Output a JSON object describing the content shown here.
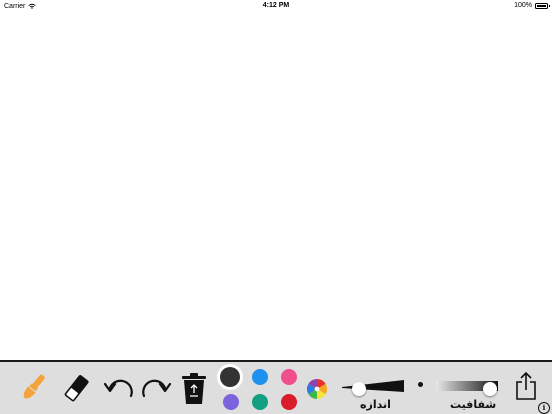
{
  "status_bar": {
    "carrier": "Carrier",
    "time": "4:12 PM",
    "battery": "100%"
  },
  "toolbar": {
    "tools": [
      {
        "name": "brush",
        "icon": "paintbrush-icon",
        "color": "#f2a33a"
      },
      {
        "name": "eraser",
        "icon": "eraser-icon"
      },
      {
        "name": "undo",
        "icon": "undo-icon"
      },
      {
        "name": "redo",
        "icon": "redo-icon"
      },
      {
        "name": "trash",
        "icon": "trash-icon"
      },
      {
        "name": "color-picker",
        "icon": "color-wheel-icon"
      },
      {
        "name": "share",
        "icon": "share-icon"
      },
      {
        "name": "info",
        "icon": "info-icon",
        "label": "i"
      }
    ],
    "colors": [
      {
        "name": "black",
        "hex": "#333333",
        "selected": true
      },
      {
        "name": "blue",
        "hex": "#1e90f0",
        "selected": false
      },
      {
        "name": "pink",
        "hex": "#ef4f8c",
        "selected": false
      },
      {
        "name": "purple",
        "hex": "#7b63dd",
        "selected": false
      },
      {
        "name": "green",
        "hex": "#13a082",
        "selected": false
      },
      {
        "name": "red",
        "hex": "#d81e2a",
        "selected": false
      }
    ],
    "size_slider": {
      "label": "اندازه",
      "value": 0.1
    },
    "opacity_slider": {
      "label": "شفافیت",
      "value": 1.0
    }
  }
}
